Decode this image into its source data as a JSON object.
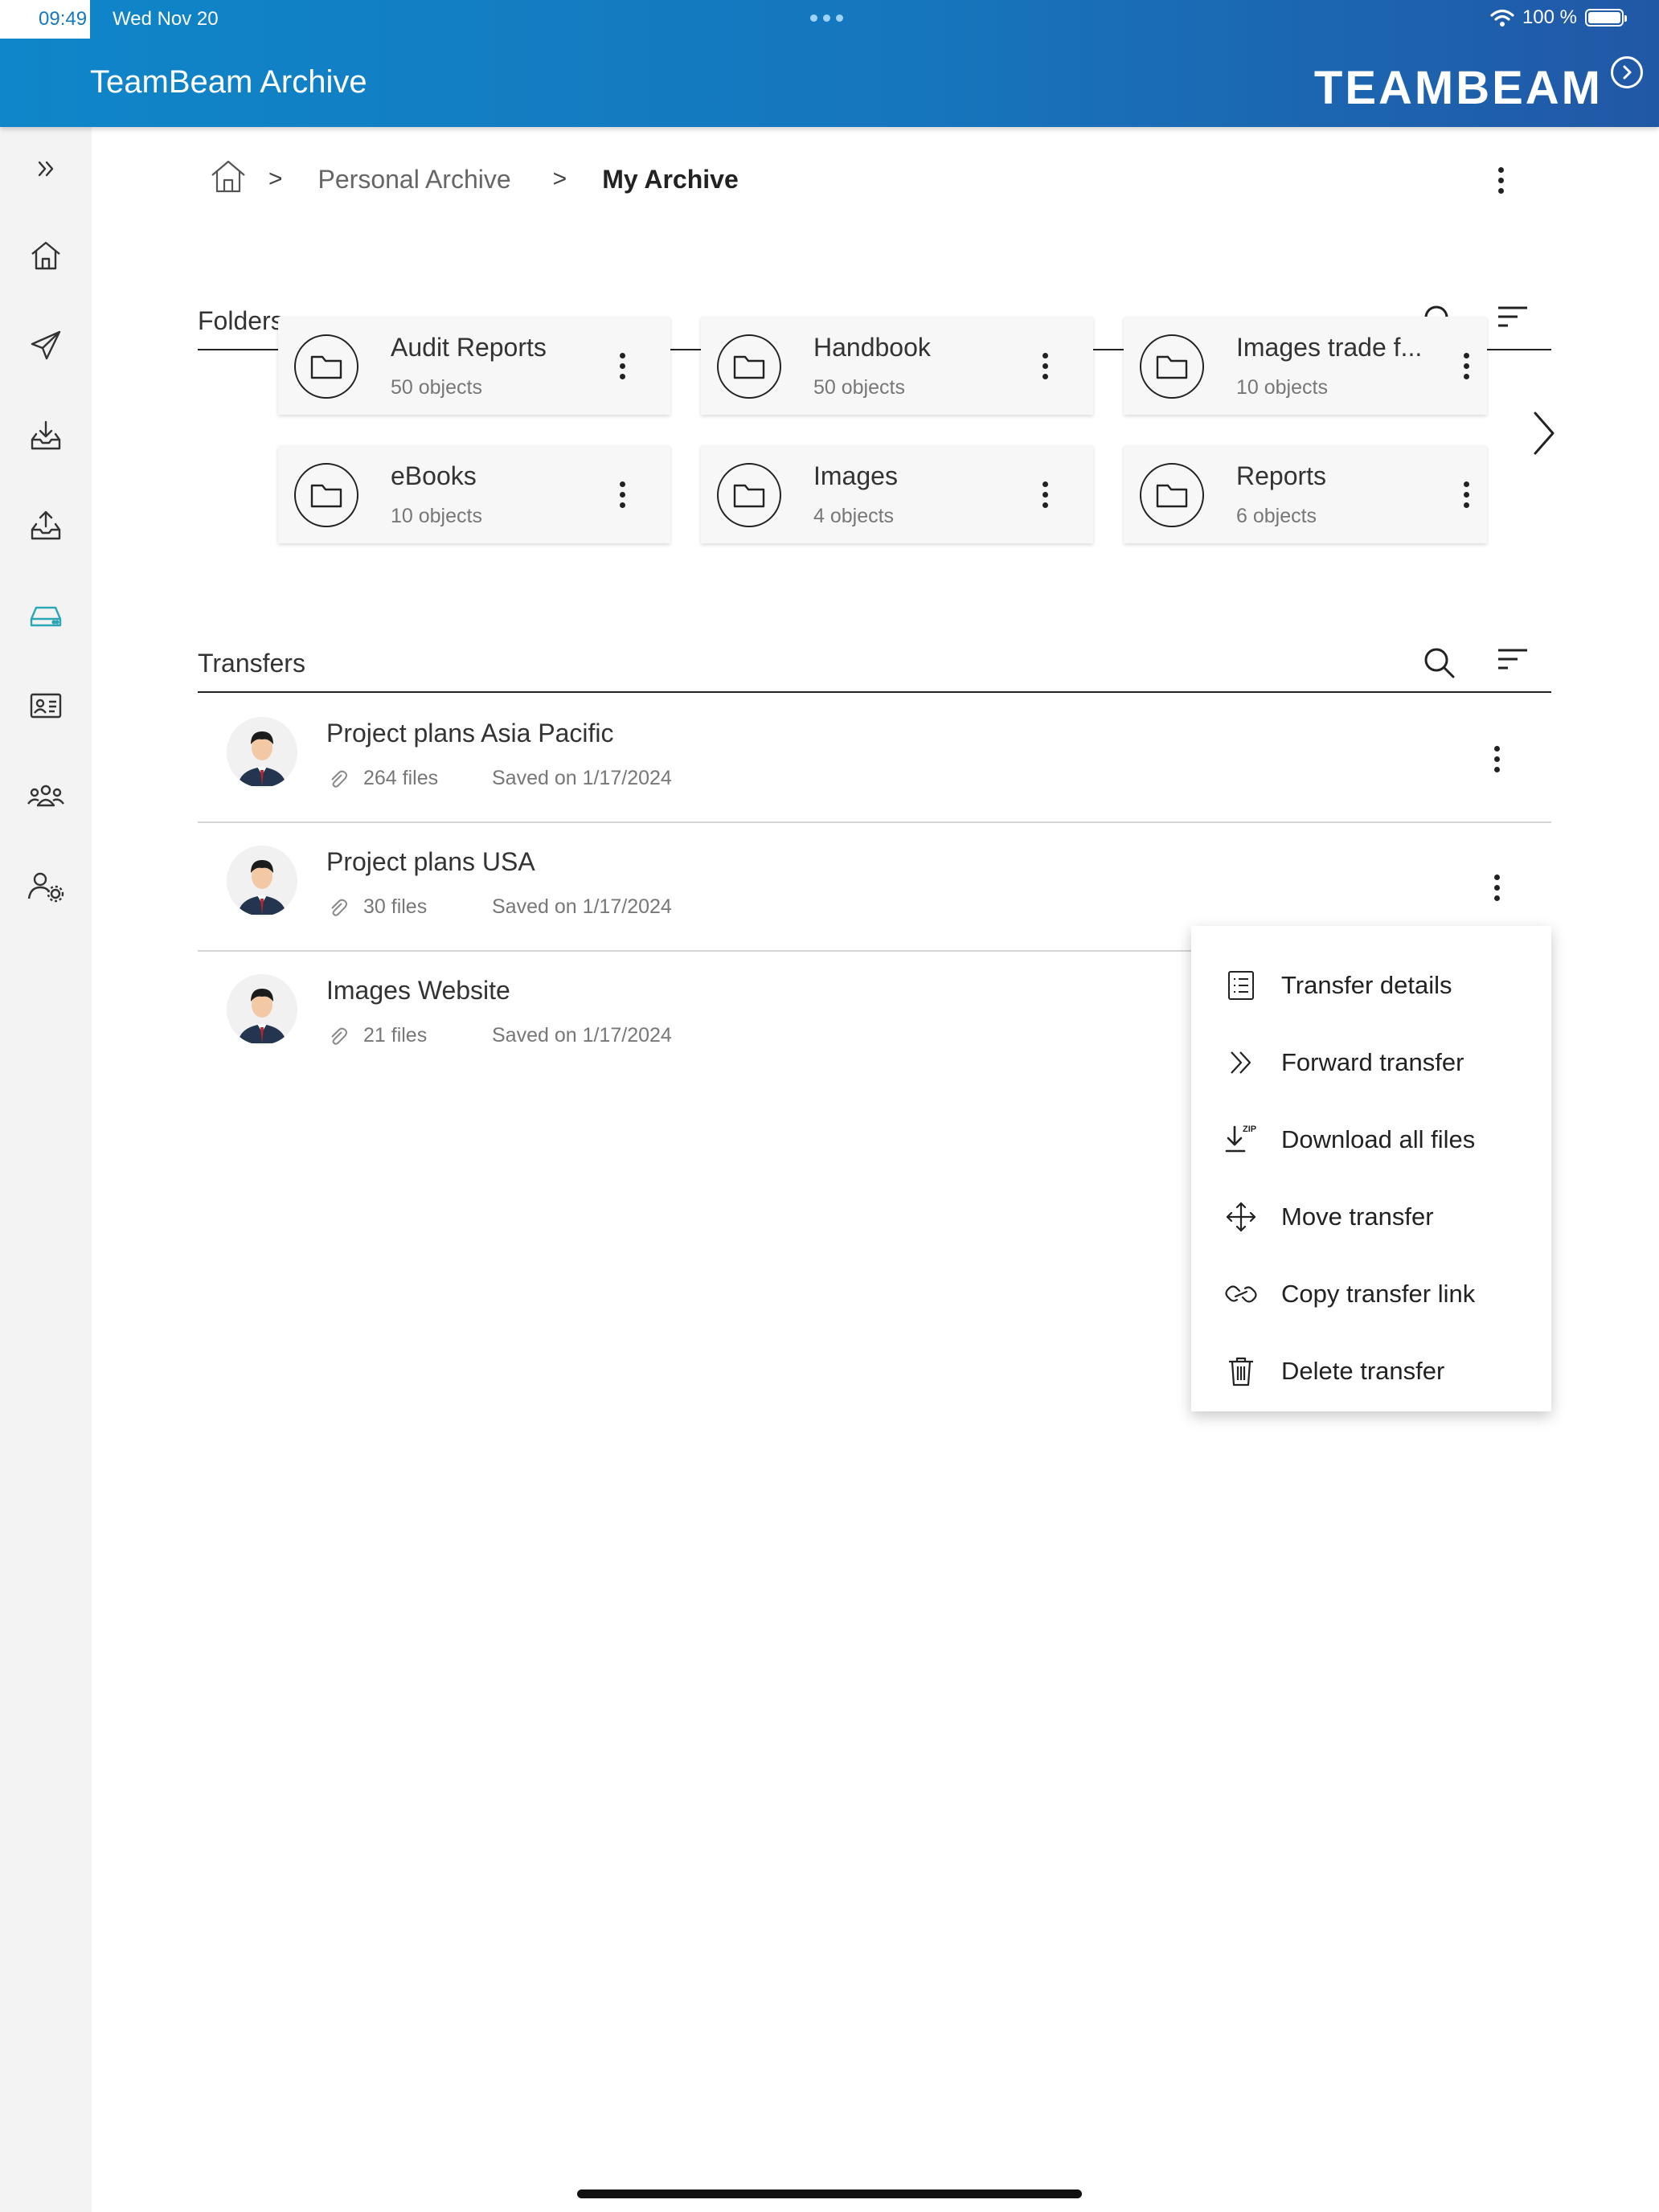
{
  "status_bar": {
    "time": "09:49",
    "date": "Wed Nov 20",
    "battery": "100 %"
  },
  "header": {
    "title": "TeamBeam Archive",
    "brand": "TEAMBEAM"
  },
  "sidebar": {
    "items": [
      {
        "icon": "expand-icon"
      },
      {
        "icon": "home-icon"
      },
      {
        "icon": "send-icon"
      },
      {
        "icon": "inbox-download-icon"
      },
      {
        "icon": "outbox-upload-icon"
      },
      {
        "icon": "archive-drive-icon",
        "active": true
      },
      {
        "icon": "contact-card-icon"
      },
      {
        "icon": "users-group-icon"
      },
      {
        "icon": "user-settings-icon"
      }
    ],
    "active_color": "#2aa6b5"
  },
  "breadcrumb": {
    "sep": ">",
    "items": [
      "Personal Archive",
      "My Archive"
    ]
  },
  "folders": {
    "title": "Folders",
    "items": [
      {
        "name": "Audit Reports",
        "count": "50 objects"
      },
      {
        "name": "Handbook",
        "count": "50 objects"
      },
      {
        "name": "Images trade f...",
        "count": "10 objects"
      },
      {
        "name": "eBooks",
        "count": "10 objects"
      },
      {
        "name": "Images",
        "count": "4 objects"
      },
      {
        "name": "Reports",
        "count": "6 objects"
      }
    ]
  },
  "transfers": {
    "title": "Transfers",
    "items": [
      {
        "name": "Project plans Asia Pacific",
        "files": "264 files",
        "saved": "Saved on 1/17/2024"
      },
      {
        "name": "Project plans USA",
        "files": "30 files",
        "saved": "Saved on 1/17/2024"
      },
      {
        "name": "Images Website",
        "files": "21 files",
        "saved": "Saved on 1/17/2024"
      }
    ]
  },
  "context_menu": {
    "items": [
      {
        "label": "Transfer details",
        "icon": "list-details-icon"
      },
      {
        "label": "Forward transfer",
        "icon": "forward-icon"
      },
      {
        "label": "Download all files",
        "icon": "download-zip-icon",
        "icon_text": "ZIP"
      },
      {
        "label": "Move transfer",
        "icon": "move-icon"
      },
      {
        "label": "Copy transfer link",
        "icon": "link-icon"
      },
      {
        "label": "Delete transfer",
        "icon": "trash-icon"
      }
    ]
  },
  "colors": {
    "header_start": "#0f86c9",
    "header_end": "#2158a6",
    "sidebar_bg": "#f3f3f3"
  }
}
